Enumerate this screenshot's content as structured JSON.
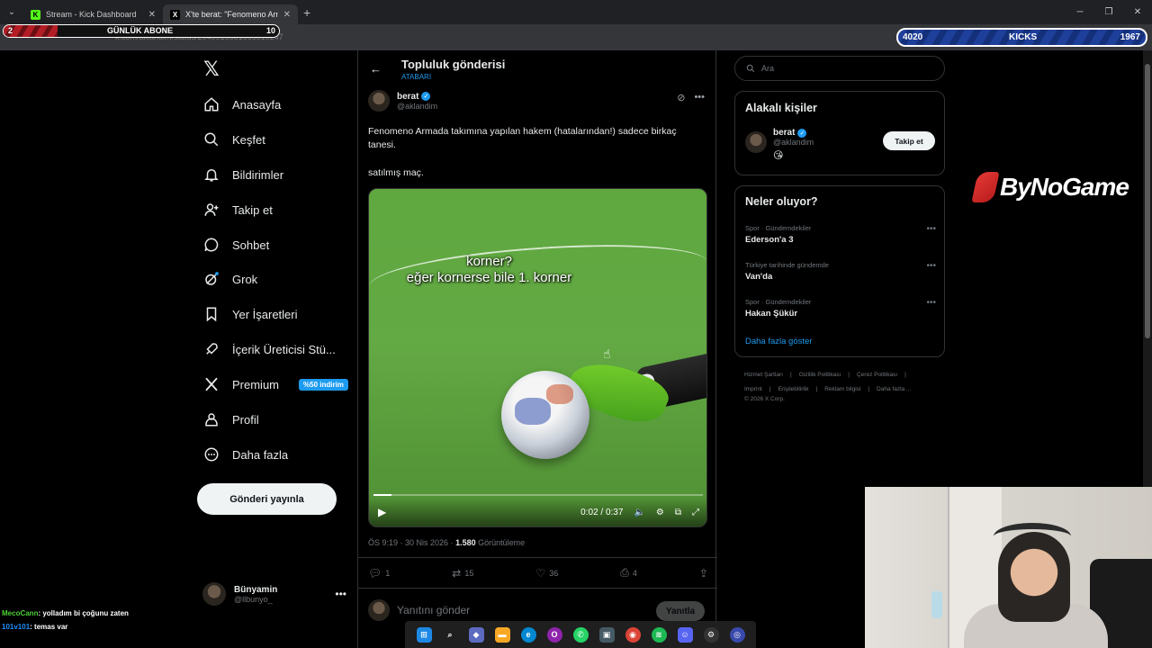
{
  "browser": {
    "tabs": [
      {
        "title": "Stream - Kick Dashboard",
        "active": false
      },
      {
        "title": "X'te berat: \"Fenomeno Armada",
        "active": true
      }
    ],
    "url": "x.com/aklandim/status/2049916681665810247"
  },
  "overlay": {
    "left_count": "2",
    "left_label": "GÜNLÜK ABONE",
    "left_goal": "10",
    "right_current": "4020",
    "right_label": "KICKS",
    "right_goal": "1967"
  },
  "nav": {
    "items": [
      {
        "label": "Anasayfa",
        "icon": "home-icon"
      },
      {
        "label": "Keşfet",
        "icon": "search-icon"
      },
      {
        "label": "Bildirimler",
        "icon": "bell-icon"
      },
      {
        "label": "Takip et",
        "icon": "follow-icon"
      },
      {
        "label": "Sohbet",
        "icon": "chat-icon"
      },
      {
        "label": "Grok",
        "icon": "grok-icon"
      },
      {
        "label": "Yer İşaretleri",
        "icon": "bookmark-icon"
      },
      {
        "label": "İçerik Üreticisi Stü...",
        "icon": "rocket-icon"
      },
      {
        "label": "Premium",
        "icon": "x-icon"
      },
      {
        "label": "Profil",
        "icon": "profile-icon"
      },
      {
        "label": "Daha fazla",
        "icon": "more-icon"
      }
    ],
    "premium_badge": "%50 indirim",
    "post_button": "Gönderi yayınla",
    "user_name": "Bünyamin",
    "user_handle": "@llbunyo_"
  },
  "header": {
    "title": "Topluluk gönderisi",
    "subtitle": "ATABARI"
  },
  "post": {
    "author_name": "berat",
    "author_handle": "@aklandim",
    "text": "Fenomeno Armada takımına yapılan hakem (hatalarından!) sadece birkaç tanesi.",
    "text2": "satılmış maç.",
    "video_caption_1": "korner?",
    "video_caption_2": "eğer kornerse bile 1. korner",
    "video_time": "0:02 / 0:37",
    "video_progress": 0.054,
    "timestamp": "ÖS 9:19 · 30 Nis 2026 · ",
    "views": "1.580",
    "views_label": " Görüntüleme",
    "replies": "1",
    "reposts": "15",
    "likes": "36",
    "bookmarks": "4",
    "reply_placeholder": "Yanıtını gönder",
    "reply_button": "Yanıtla"
  },
  "sidebar": {
    "search_placeholder": "Ara",
    "related_title": "Alakalı kişiler",
    "related_name": "berat",
    "related_handle": "@aklandim",
    "related_emoji": "😘",
    "follow_label": "Takip et",
    "trends_title": "Neler oluyor?",
    "trends": [
      {
        "category": "Spor · Gündemdekiler",
        "title": "Ederson'a 3"
      },
      {
        "category": "Türkiye tarihinde gündemde",
        "title": "Van'da"
      },
      {
        "category": "Spor · Gündemdekiler",
        "title": "Hakan Şükür"
      }
    ],
    "show_more": "Daha fazla göster",
    "footer": [
      "Hizmet Şartları",
      "|",
      "Gizlilik Politikası",
      "|",
      "Çerez Politikası",
      "|",
      "Imprint",
      "|",
      "Erişilebilirlik",
      "|",
      "Reklam bilgisi",
      "|",
      "Daha fazla ...",
      "© 2026 X Corp."
    ]
  },
  "brand": {
    "logo_text": "ByNoGame"
  },
  "chat": [
    {
      "user": "MecoCann",
      "message": ": yolladım bi çoğunu zaten"
    },
    {
      "user": "101v101",
      "message": ": temas var"
    }
  ]
}
